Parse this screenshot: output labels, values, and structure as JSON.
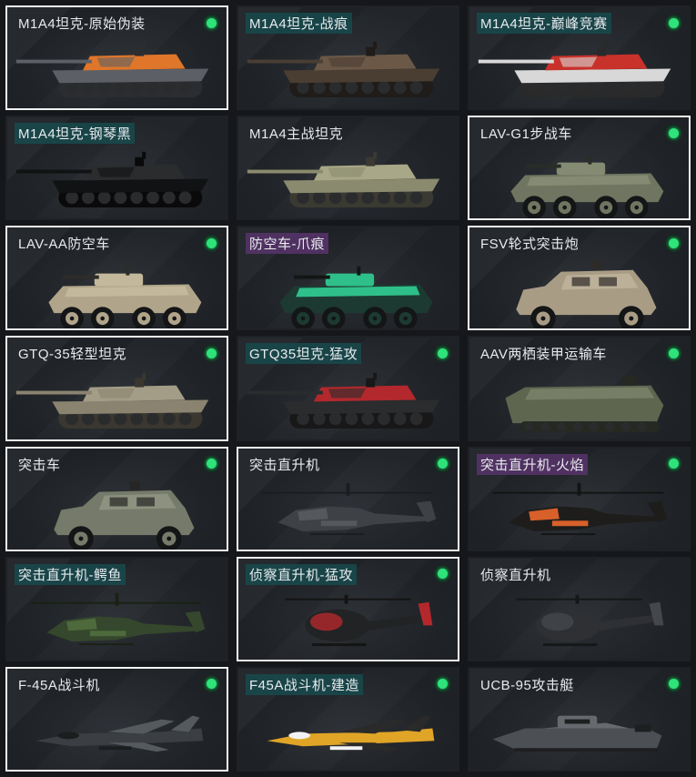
{
  "vehicles": [
    {
      "name": "M1A4坦克-原始伪装",
      "owned": true,
      "selected": true,
      "highlight": "none",
      "kind": "tank",
      "colors": [
        "#5c6066",
        "#e0762a",
        "#2b2d31"
      ]
    },
    {
      "name": "M1A4坦克-战痕",
      "owned": false,
      "selected": false,
      "highlight": "teal",
      "kind": "tank",
      "colors": [
        "#4a3e33",
        "#6b5847",
        "#1f1c19"
      ]
    },
    {
      "name": "M1A4坦克-巅峰竞赛",
      "owned": true,
      "selected": false,
      "highlight": "teal",
      "kind": "tank",
      "colors": [
        "#d8d8d8",
        "#c8322a",
        "#2a2a2a"
      ]
    },
    {
      "name": "M1A4坦克-钢琴黑",
      "owned": false,
      "selected": false,
      "highlight": "teal",
      "kind": "tank",
      "colors": [
        "#111214",
        "#2a2c2e",
        "#0a0a0b"
      ]
    },
    {
      "name": "M1A4主战坦克",
      "owned": false,
      "selected": false,
      "highlight": "none",
      "kind": "tank",
      "colors": [
        "#8a8a6e",
        "#a8a888",
        "#3a3a32"
      ]
    },
    {
      "name": "LAV-G1步战车",
      "owned": true,
      "selected": true,
      "highlight": "none",
      "kind": "lav",
      "colors": [
        "#6f7560",
        "#848b72",
        "#2a2c28"
      ]
    },
    {
      "name": "LAV-AA防空车",
      "owned": true,
      "selected": true,
      "highlight": "none",
      "kind": "lav",
      "colors": [
        "#b0a48a",
        "#c4b89c",
        "#2e2c28"
      ]
    },
    {
      "name": "防空车-爪痕",
      "owned": false,
      "selected": false,
      "highlight": "purple",
      "kind": "lav",
      "colors": [
        "#1c3a32",
        "#2fbf8a",
        "#141616"
      ]
    },
    {
      "name": "FSV轮式突击炮",
      "owned": true,
      "selected": true,
      "highlight": "none",
      "kind": "armored-car",
      "colors": [
        "#a99c85",
        "#bcb099",
        "#2d2b28"
      ]
    },
    {
      "name": "GTQ-35轻型坦克",
      "owned": true,
      "selected": true,
      "highlight": "none",
      "kind": "tank",
      "colors": [
        "#8a8370",
        "#a39c86",
        "#3a3730"
      ]
    },
    {
      "name": "GTQ35坦克-猛攻",
      "owned": true,
      "selected": false,
      "highlight": "teal",
      "kind": "tank",
      "colors": [
        "#2a2c2e",
        "#b3282c",
        "#181818"
      ]
    },
    {
      "name": "AAV两栖装甲运输车",
      "owned": true,
      "selected": false,
      "highlight": "none",
      "kind": "aav",
      "colors": [
        "#5f6650",
        "#777e66",
        "#262822"
      ]
    },
    {
      "name": "突击车",
      "owned": true,
      "selected": true,
      "highlight": "none",
      "kind": "armored-car",
      "colors": [
        "#767a6a",
        "#8d917f",
        "#262724"
      ]
    },
    {
      "name": "突击直升机",
      "owned": true,
      "selected": true,
      "highlight": "none",
      "kind": "heli",
      "colors": [
        "#3e4246",
        "#55595d",
        "#1c1d1f"
      ]
    },
    {
      "name": "突击直升机-火焰",
      "owned": true,
      "selected": false,
      "highlight": "purple",
      "kind": "heli",
      "colors": [
        "#1e1d1c",
        "#d8602a",
        "#141414"
      ]
    },
    {
      "name": "突击直升机-鳄鱼",
      "owned": false,
      "selected": false,
      "highlight": "teal",
      "kind": "heli",
      "colors": [
        "#35472c",
        "#4e6a3c",
        "#1a2114"
      ]
    },
    {
      "name": "侦察直升机-猛攻",
      "owned": true,
      "selected": true,
      "highlight": "teal",
      "kind": "scout",
      "colors": [
        "#222325",
        "#b3282c",
        "#141414"
      ]
    },
    {
      "name": "侦察直升机",
      "owned": false,
      "selected": false,
      "highlight": "none",
      "kind": "scout",
      "colors": [
        "#2e3033",
        "#44474b",
        "#161718"
      ]
    },
    {
      "name": "F-45A战斗机",
      "owned": true,
      "selected": true,
      "highlight": "none",
      "kind": "jet",
      "colors": [
        "#3b3e42",
        "#555a5f",
        "#1c1d1f"
      ]
    },
    {
      "name": "F45A战斗机-建造",
      "owned": true,
      "selected": false,
      "highlight": "teal",
      "kind": "jet",
      "colors": [
        "#e0a526",
        "#2a2a2a",
        "#f2f2f2"
      ]
    },
    {
      "name": "UCB-95攻击艇",
      "owned": true,
      "selected": false,
      "highlight": "none",
      "kind": "boat",
      "colors": [
        "#4c5054",
        "#66696d",
        "#1e1f21"
      ]
    }
  ]
}
